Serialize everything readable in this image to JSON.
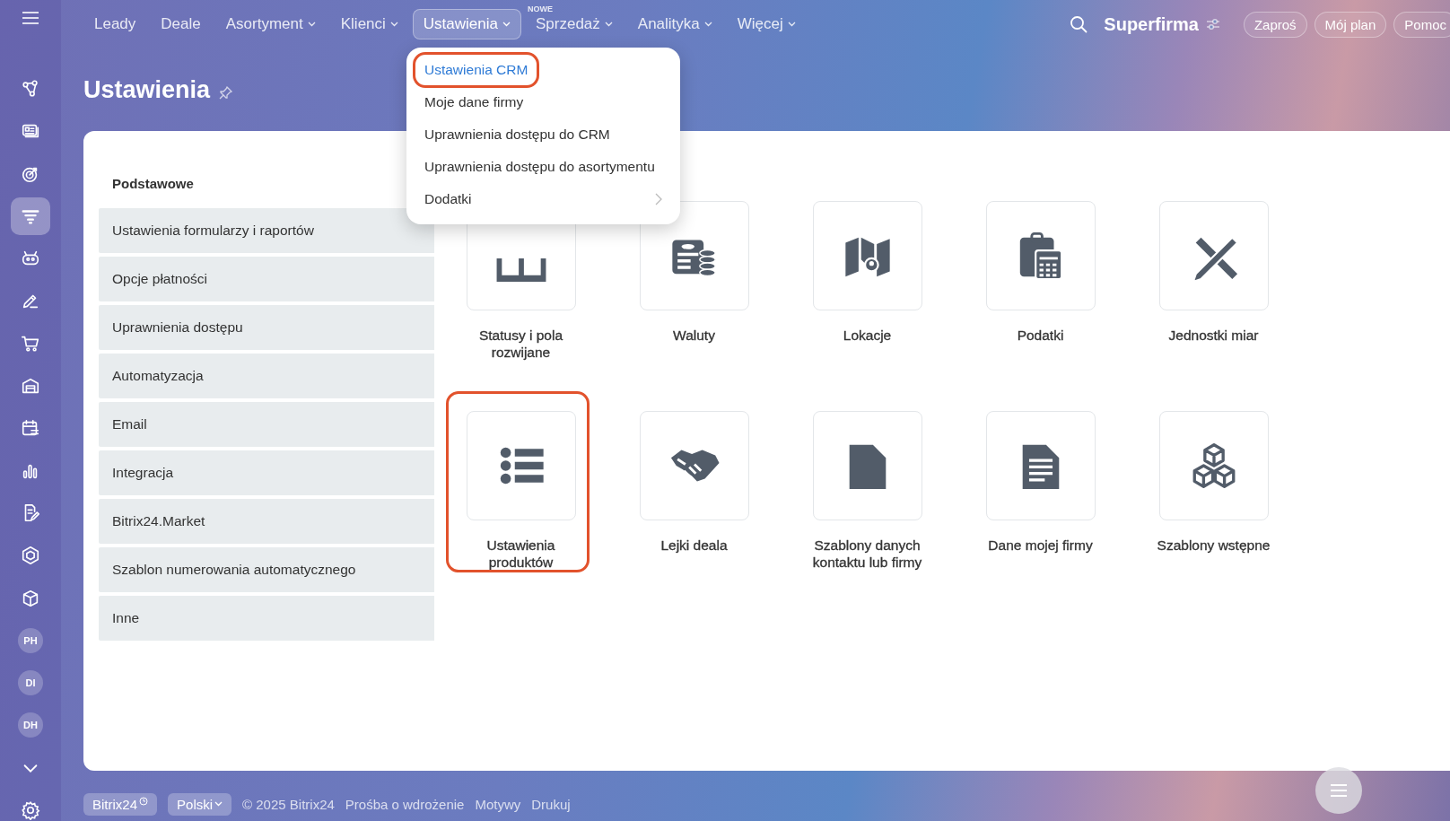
{
  "top_nav": {
    "items": [
      {
        "label": "Leady",
        "dropdown": false,
        "selected": false
      },
      {
        "label": "Deale",
        "dropdown": false,
        "selected": false
      },
      {
        "label": "Asortyment",
        "dropdown": true,
        "selected": false
      },
      {
        "label": "Klienci",
        "dropdown": true,
        "selected": false
      },
      {
        "label": "Ustawienia",
        "dropdown": true,
        "selected": true
      },
      {
        "label": "Sprzedaż",
        "dropdown": true,
        "selected": false,
        "badge": "NOWE"
      },
      {
        "label": "Analityka",
        "dropdown": true,
        "selected": false
      },
      {
        "label": "Więcej",
        "dropdown": true,
        "selected": false
      }
    ],
    "company": "Superfirma",
    "buttons": [
      "Zaproś",
      "Mój plan",
      "Pomoc"
    ]
  },
  "sidebar": {
    "items": [
      {
        "kind": "icon",
        "selected": false
      },
      {
        "kind": "icon",
        "selected": false
      },
      {
        "kind": "icon",
        "selected": false
      },
      {
        "kind": "icon",
        "selected": true
      },
      {
        "kind": "icon",
        "selected": false
      },
      {
        "kind": "icon",
        "selected": false
      },
      {
        "kind": "icon",
        "selected": false
      },
      {
        "kind": "icon",
        "selected": false
      },
      {
        "kind": "icon",
        "selected": false
      },
      {
        "kind": "icon",
        "selected": false
      },
      {
        "kind": "icon",
        "selected": false
      },
      {
        "kind": "icon",
        "selected": false
      },
      {
        "kind": "icon",
        "selected": false
      },
      {
        "kind": "avatar",
        "initials": "PH",
        "selected": false
      },
      {
        "kind": "avatar",
        "initials": "DI",
        "selected": false
      },
      {
        "kind": "avatar",
        "initials": "DH",
        "selected": false
      }
    ]
  },
  "page": {
    "title": "Ustawienia"
  },
  "dropdown": {
    "items": [
      {
        "label": "Ustawienia CRM",
        "selected": true,
        "highlighted": true,
        "submenu": false
      },
      {
        "label": "Moje dane firmy",
        "selected": false,
        "highlighted": false,
        "submenu": false
      },
      {
        "label": "Uprawnienia dostępu do CRM",
        "selected": false,
        "highlighted": false,
        "submenu": false
      },
      {
        "label": "Uprawnienia dostępu do asortymentu",
        "selected": false,
        "highlighted": false,
        "submenu": false
      },
      {
        "label": "Dodatki",
        "selected": false,
        "highlighted": false,
        "submenu": true
      }
    ]
  },
  "settings_nav": {
    "heading": "Podstawowe",
    "items": [
      "Ustawienia formularzy i raportów",
      "Opcje płatności",
      "Uprawnienia dostępu",
      "Automatyzacja",
      "Email",
      "Integracja",
      "Bitrix24.Market",
      "Szablon numerowania automatycznego",
      "Inne"
    ]
  },
  "tiles": [
    {
      "label": "Statusy i pola rozwijane",
      "highlighted": false
    },
    {
      "label": "Waluty",
      "highlighted": false
    },
    {
      "label": "Lokacje",
      "highlighted": false
    },
    {
      "label": "Podatki",
      "highlighted": false
    },
    {
      "label": "Jednostki miar",
      "highlighted": false
    },
    {
      "label": "Ustawienia produktów",
      "highlighted": true
    },
    {
      "label": "Lejki deala",
      "highlighted": false
    },
    {
      "label": "Szablony danych kontaktu lub firmy",
      "highlighted": false
    },
    {
      "label": "Dane mojej firmy",
      "highlighted": false
    },
    {
      "label": "Szablony wstępne",
      "highlighted": false
    }
  ],
  "footer": {
    "brand": "Bitrix24",
    "language": "Polski",
    "links": [
      "© 2025 Bitrix24",
      "Prośba o wdrożenie",
      "Motywy",
      "Drukuj"
    ]
  }
}
